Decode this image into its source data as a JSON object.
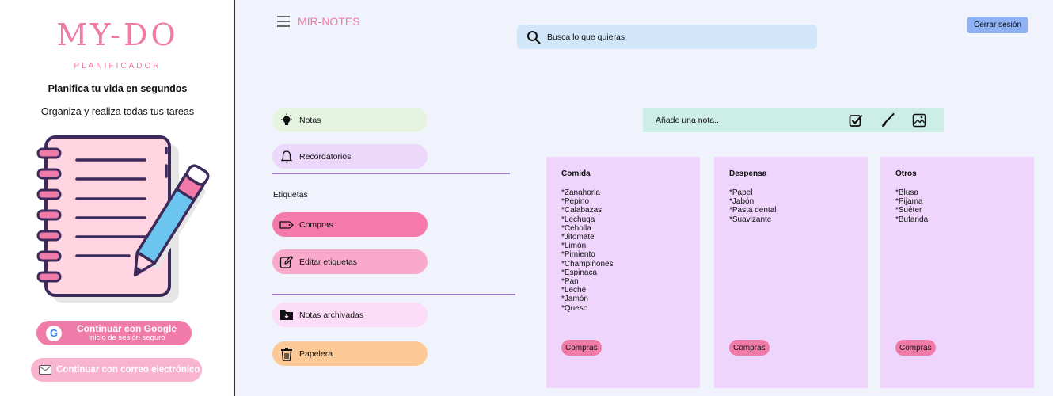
{
  "brand": {
    "logo": "MY-DO",
    "subtitle": "PLANIFICADOR",
    "tagline": "Planifica tu vida en segundos",
    "description": "Organiza y realiza todas tus tareas"
  },
  "auth": {
    "google_label": "Continuar con Google",
    "google_sub": "Inicio de sesión seguro",
    "email_label": "Continuar con correo electrónico"
  },
  "topbar": {
    "app_title": "MIR-NOTES",
    "search_placeholder": "Busca lo que quieras",
    "logout_label": "Cerrar sesión"
  },
  "nav": {
    "notes": "Notas",
    "reminders": "Recordatorios",
    "labels_heading": "Etiquetas",
    "label_compras": "Compras",
    "edit_labels": "Editar etiquetas",
    "archived": "Notas archivadas",
    "trash": "Papelera"
  },
  "add_note": {
    "placeholder": "Añade una nota..."
  },
  "notes": [
    {
      "title": "Comida",
      "items": [
        "*Zanahoria",
        "*Pepino",
        "*Calabazas",
        "*Lechuga",
        "*Cebolla",
        "*Jitomate",
        "*Limón",
        "*Pimiento",
        "*Champiñones",
        "*Espinaca",
        "*Pan",
        "*Leche",
        "*Jamón",
        "*Queso"
      ],
      "tag": "Compras"
    },
    {
      "title": "Despensa",
      "items": [
        "*Papel",
        "*Jabón",
        "*Pasta dental",
        "*Suavizante"
      ],
      "tag": "Compras"
    },
    {
      "title": "Otros",
      "items": [
        "*Blusa",
        "*Pijama",
        "*Suéter",
        "*Bufanda"
      ],
      "tag": "Compras"
    }
  ],
  "colors": {
    "accent_pink": "#f07aa8",
    "notes_pill": "#e6f4df",
    "reminders_pill": "#ecd8fb",
    "compras_pill": "#f57aaa",
    "edit_pill": "#f9aacb",
    "archived_pill": "#fcdcf6",
    "trash_pill": "#fdc996",
    "card_bg": "#efd5fc",
    "add_note_bg": "#cdeee6",
    "search_bg": "#d1e6f8",
    "logout_bg": "#8fb2f5"
  },
  "icons": {
    "menu": "hamburger-menu-icon",
    "search": "search-icon",
    "notes": "lightbulb-icon",
    "reminders": "bell-icon",
    "label": "label-tag-icon",
    "edit": "edit-pencil-icon",
    "archive": "archive-folder-icon",
    "trash": "trash-icon",
    "checkbox": "checkbox-icon",
    "brush": "brush-icon",
    "image": "image-icon",
    "google": "google-icon",
    "mail": "mail-icon"
  }
}
